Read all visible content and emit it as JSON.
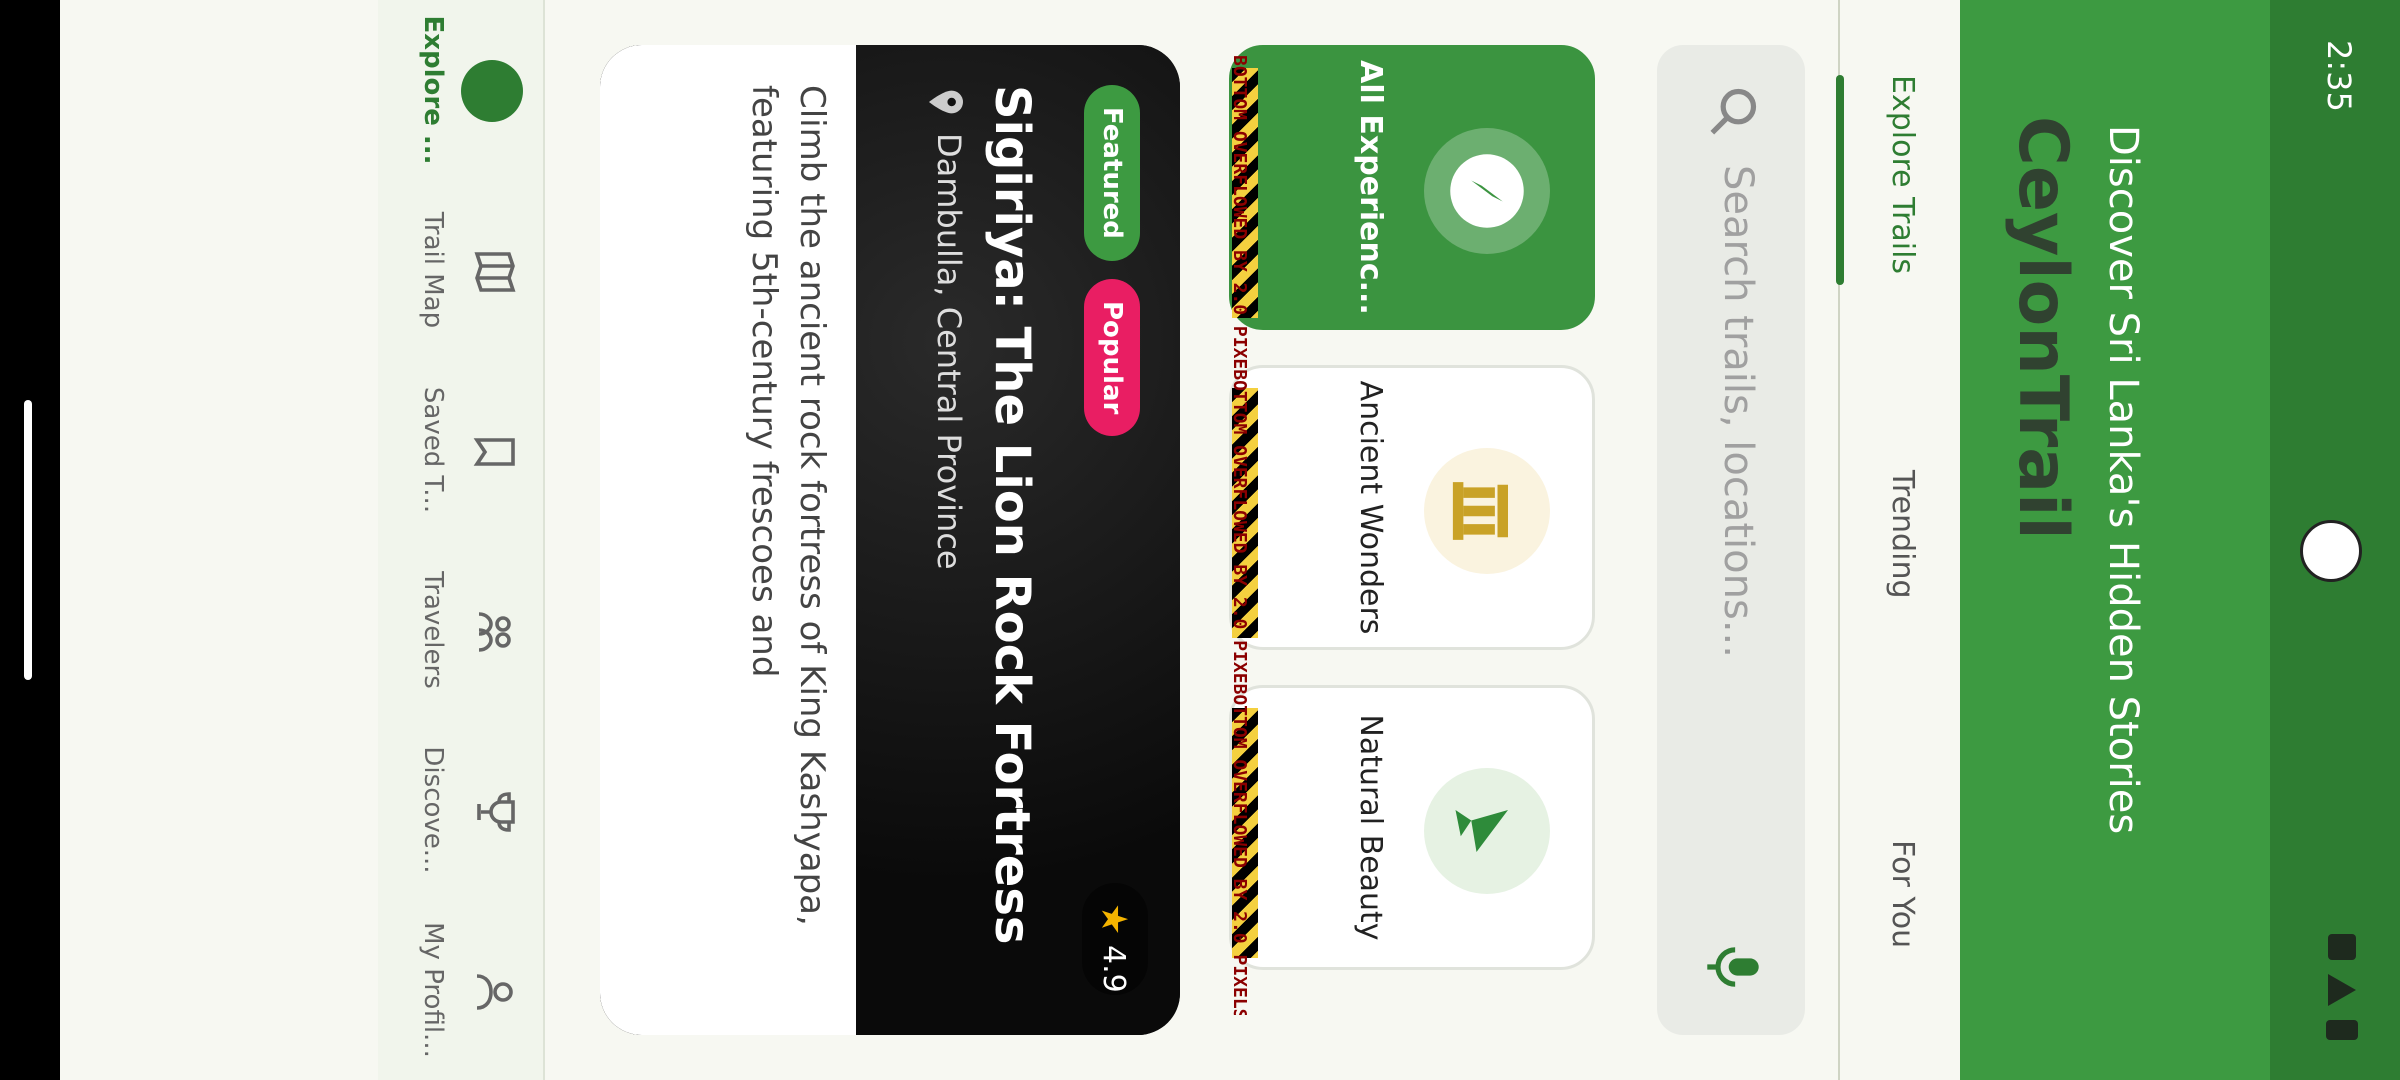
{
  "status": {
    "time": "2:35"
  },
  "header": {
    "brand": "CeylonTrail",
    "tagline": "Discover Sri Lanka's Hidden Stories"
  },
  "tabs": [
    {
      "label": "Explore Trails",
      "active": true
    },
    {
      "label": "Trending",
      "active": false
    },
    {
      "label": "For You",
      "active": false
    }
  ],
  "search": {
    "placeholder": "Search trails, locations..."
  },
  "categories": [
    {
      "label": "All Experienc...",
      "icon": "compass-icon",
      "active": true,
      "overflow": "BOTTOM OVERFLOWED BY 2.0 PIXE"
    },
    {
      "label": "Ancient Wonders",
      "icon": "temple-icon",
      "active": false,
      "overflow": "BOTTOM OVERFLOWED BY 2.0 PIXE"
    },
    {
      "label": "Natural Beauty",
      "icon": "leaf-icon",
      "active": false,
      "overflow": "BOTTOM OVERFLOWED BY 2.0 PIXELS"
    }
  ],
  "card": {
    "chips": [
      "Featured",
      "Popular"
    ],
    "rating": "4.9",
    "title": "Sigiriya: The Lion Rock Fortress",
    "location": "Dambulla, Central Province",
    "description": "Climb the ancient rock fortress of King Kashyapa, featuring 5th-century frescoes and"
  },
  "bottom_nav": [
    {
      "label": "Explore ...",
      "icon": "compass-icon",
      "active": true
    },
    {
      "label": "Trail Map",
      "icon": "map-icon",
      "active": false
    },
    {
      "label": "Saved T...",
      "icon": "bookmark-icon",
      "active": false
    },
    {
      "label": "Travelers",
      "icon": "people-icon",
      "active": false
    },
    {
      "label": "Discove...",
      "icon": "trophy-icon",
      "active": false
    },
    {
      "label": "My Profil...",
      "icon": "person-icon",
      "active": false
    }
  ]
}
